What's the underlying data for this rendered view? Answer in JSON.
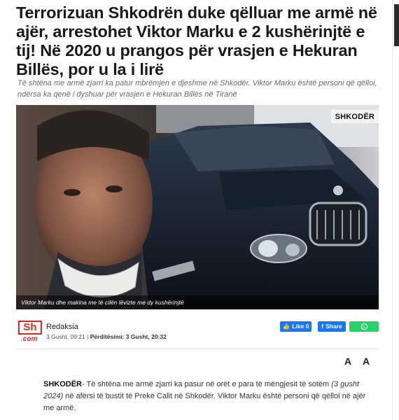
{
  "article": {
    "headline": "Terrorizuan Shkodrën duke qëlluar me armë në ajër, arrestohet Viktor Marku e 2 kushërinjtë e tij! Në 2020 u prangos për vrasjen e Hekuran Billës, por u la i lirë",
    "subhead": "Të shtëna me armë zjarri ka patur mbrëmjen e djeshme në Shkodër. Viktor Marku është personi që qëlloi, ndërsa ka qenë i dyshuar për vrasjen e Hekuran Billës në Tiranë",
    "image_badge": "SHKODËR",
    "image_caption": "Viktor Marku dhe makina me të cilën lëvizte me dy kushërinjtë"
  },
  "author": {
    "logo_main": "Sh",
    "logo_sub": ".com",
    "name": "Redaksia",
    "published": "3 Gusht, 09:21",
    "updated_label": "Përditësimi: 3 Gusht, 20:32"
  },
  "share": {
    "like_label": "Like 0",
    "share_label": "Share"
  },
  "font_tools": {
    "decrease_label": "A",
    "increase_label": "A"
  },
  "body": {
    "place": "SHKODËR",
    "text1": "- Të shtëna me armë zjarri ka pasur në orët e para të mëngjesit të sotëm ",
    "date": "(3 gusht 2024)",
    "text2": " në afërsi të bustit të Prekë Calit në Shkodër. Viktor Marku është personi që qëlloi në ajër me armë."
  },
  "colors": {
    "brand_red": "#d12a1e",
    "facebook": "#1877f2",
    "whatsapp": "#25d366"
  }
}
